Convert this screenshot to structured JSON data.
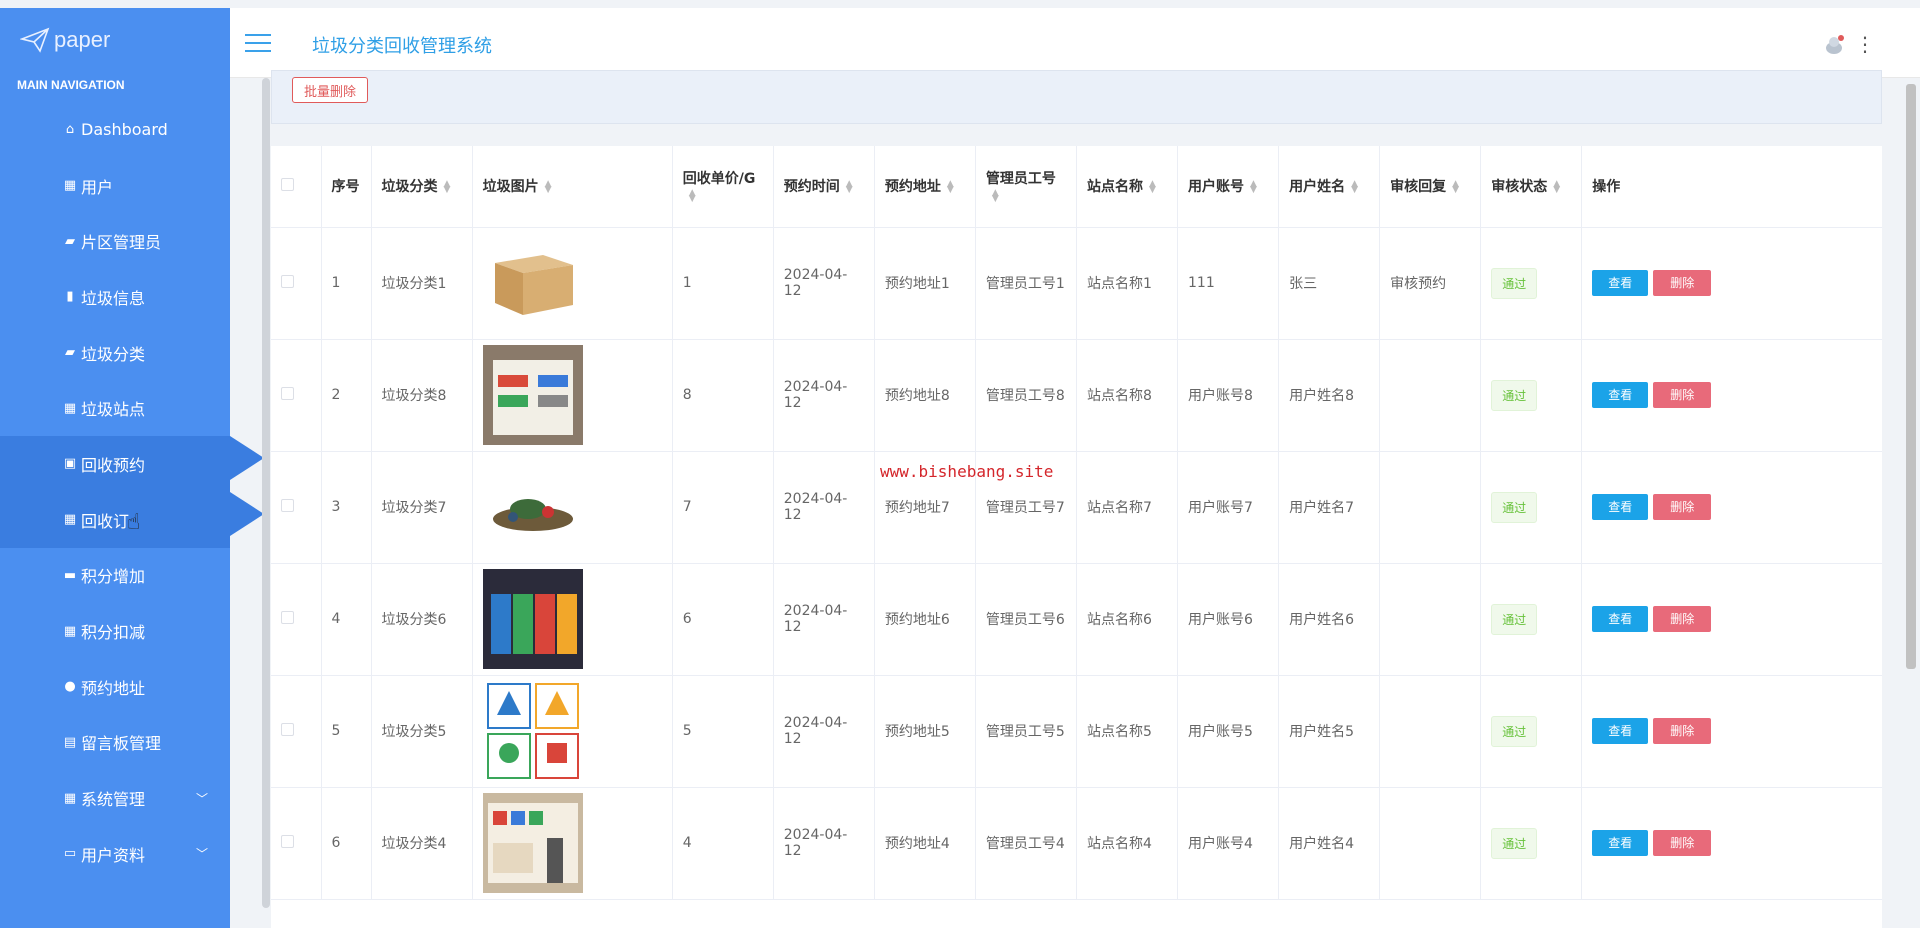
{
  "logo": {
    "text": "paper"
  },
  "nav": {
    "heading": "MAIN NAVIGATION",
    "items": [
      {
        "label": "Dashboard",
        "icon": "home-icon"
      },
      {
        "label": "用户",
        "icon": "grid-icon"
      },
      {
        "label": "片区管理员",
        "icon": "chat-icon"
      },
      {
        "label": "垃圾信息",
        "icon": "bar-chart-icon"
      },
      {
        "label": "垃圾分类",
        "icon": "comment-icon"
      },
      {
        "label": "垃圾站点",
        "icon": "grid-icon"
      },
      {
        "label": "回收预约",
        "icon": "briefcase-icon"
      },
      {
        "label": "回收订",
        "icon": "grid-icon"
      },
      {
        "label": "积分增加",
        "icon": "ticket-icon"
      },
      {
        "label": "积分扣减",
        "icon": "grid-icon"
      },
      {
        "label": "预约地址",
        "icon": "user-icon"
      },
      {
        "label": "留言板管理",
        "icon": "clipboard-icon"
      },
      {
        "label": "系统管理",
        "icon": "grid-icon"
      },
      {
        "label": "用户资料",
        "icon": "card-icon"
      }
    ]
  },
  "header": {
    "title": "垃圾分类回收管理系统"
  },
  "toolbar": {
    "batch_delete": "批量删除"
  },
  "table": {
    "columns": [
      "序号",
      "垃圾分类",
      "垃圾图片",
      "回收单价/G",
      "预约时间",
      "预约地址",
      "管理员工号",
      "站点名称",
      "用户账号",
      "用户姓名",
      "审核回复",
      "审核状态",
      "操作"
    ],
    "view_label": "查看",
    "delete_label": "删除",
    "rows": [
      {
        "no": "1",
        "category": "垃圾分类1",
        "image": "cardboard-box",
        "price": "1",
        "time": "2024-04-12",
        "address": "预约地址1",
        "admin": "管理员工号1",
        "station": "站点名称1",
        "account": "111",
        "name": "张三",
        "reply": "审核预约",
        "status": "通过"
      },
      {
        "no": "2",
        "category": "垃圾分类8",
        "image": "sorting-board",
        "price": "8",
        "time": "2024-04-12",
        "address": "预约地址8",
        "admin": "管理员工号8",
        "station": "站点名称8",
        "account": "用户账号8",
        "name": "用户姓名8",
        "reply": "",
        "status": "通过"
      },
      {
        "no": "3",
        "category": "垃圾分类7",
        "image": "trash-pile",
        "price": "7",
        "time": "2024-04-12",
        "address": "预约地址7",
        "admin": "管理员工号7",
        "station": "站点名称7",
        "account": "用户账号7",
        "name": "用户姓名7",
        "reply": "",
        "status": "通过"
      },
      {
        "no": "4",
        "category": "垃圾分类6",
        "image": "color-bins",
        "price": "6",
        "time": "2024-04-12",
        "address": "预约地址6",
        "admin": "管理员工号6",
        "station": "站点名称6",
        "account": "用户账号6",
        "name": "用户姓名6",
        "reply": "",
        "status": "通过"
      },
      {
        "no": "5",
        "category": "垃圾分类5",
        "image": "recycle-signs",
        "price": "5",
        "time": "2024-04-12",
        "address": "预约地址5",
        "admin": "管理员工号5",
        "station": "站点名称5",
        "account": "用户账号5",
        "name": "用户姓名5",
        "reply": "",
        "status": "通过"
      },
      {
        "no": "6",
        "category": "垃圾分类4",
        "image": "display-wall",
        "price": "4",
        "time": "2024-04-12",
        "address": "预约地址4",
        "admin": "管理员工号4",
        "station": "站点名称4",
        "account": "用户账号4",
        "name": "用户姓名4",
        "reply": "",
        "status": "通过"
      }
    ]
  },
  "watermark": "www.bishebang.site",
  "colors": {
    "sidebar": "#4b8ff0",
    "accent": "#2f9fe6",
    "view": "#1ba3e8",
    "delete": "#e86a7a",
    "status": "#67c23a"
  }
}
